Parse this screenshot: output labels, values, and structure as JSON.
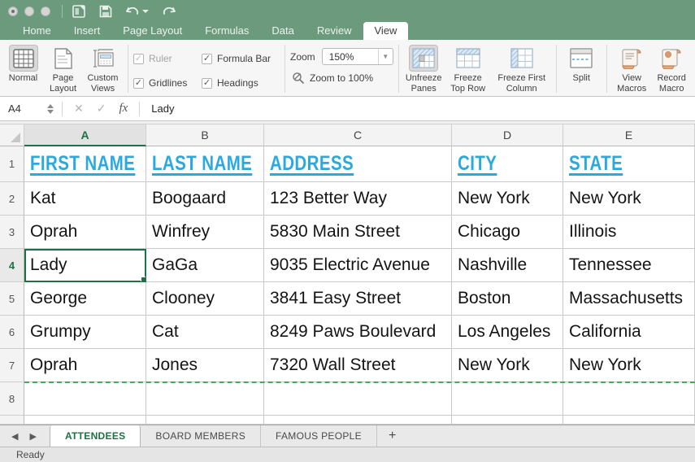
{
  "colors": {
    "title_green": "#6b9a7c",
    "accent_green": "#1e7145",
    "header_blue": "#2aa9e0"
  },
  "icons": {
    "cancel": "✕",
    "confirm": "✓",
    "check": "✓",
    "dropdown_caret": "▼",
    "nav_left": "◀",
    "nav_right": "▶"
  },
  "ribbon_tabs": {
    "items": [
      "Home",
      "Insert",
      "Page Layout",
      "Formulas",
      "Data",
      "Review",
      "View"
    ],
    "active": "View"
  },
  "ribbon": {
    "workbook_views": [
      {
        "line1": "Normal",
        "line2": ""
      },
      {
        "line1": "Page",
        "line2": "Layout"
      },
      {
        "line1": "Custom",
        "line2": "Views"
      }
    ],
    "show_options": [
      {
        "label": "Ruler",
        "glyph": "✓"
      },
      {
        "label": "Formula Bar",
        "glyph": "✓"
      },
      {
        "label": "Gridlines",
        "glyph": "✓"
      },
      {
        "label": "Headings",
        "glyph": "✓"
      }
    ],
    "zoom": {
      "label": "Zoom",
      "value": "150%",
      "zoom_100_label": "Zoom to 100%"
    },
    "freeze_buttons": [
      {
        "line1": "Unfreeze",
        "line2": "Panes"
      },
      {
        "line1": "Freeze",
        "line2": "Top Row"
      },
      {
        "line1": "Freeze First",
        "line2": "Column"
      }
    ],
    "split_label": "Split",
    "macro_buttons": [
      {
        "line1": "View",
        "line2": "Macros"
      },
      {
        "line1": "Record",
        "line2": "Macro"
      }
    ]
  },
  "formula_bar": {
    "name_box": "A4",
    "fx_label": "fx",
    "value": "Lady"
  },
  "sheet": {
    "columns": [
      "A",
      "B",
      "C",
      "D",
      "E"
    ],
    "selected_cell": "A4",
    "selected_column": "A",
    "selected_row": "4",
    "header_row": {
      "num": "1",
      "cells": [
        "FIRST NAME",
        "LAST NAME",
        "ADDRESS",
        "CITY",
        "STATE"
      ]
    },
    "rows": [
      {
        "num": "2",
        "cells": [
          "Kat",
          "Boogaard",
          "123 Better Way",
          "New York",
          "New York"
        ]
      },
      {
        "num": "3",
        "cells": [
          "Oprah",
          "Winfrey",
          "5830 Main Street",
          "Chicago",
          "Illinois"
        ]
      },
      {
        "num": "4",
        "cells": [
          "Lady",
          "GaGa",
          "9035 Electric Avenue",
          "Nashville",
          "Tennessee"
        ]
      },
      {
        "num": "5",
        "cells": [
          "George",
          "Clooney",
          "3841 Easy Street",
          "Boston",
          "Massachusetts"
        ]
      },
      {
        "num": "6",
        "cells": [
          "Grumpy",
          "Cat",
          "8249 Paws Boulevard",
          "Los Angeles",
          "California"
        ]
      },
      {
        "num": "7",
        "cells": [
          "Oprah",
          "Jones",
          "7320 Wall Street",
          "New York",
          "New York"
        ]
      },
      {
        "num": "8",
        "cells": [
          "",
          "",
          "",
          "",
          ""
        ]
      }
    ]
  },
  "sheet_tabs": {
    "tabs": [
      {
        "label": "ATTENDEES"
      },
      {
        "label": "BOARD MEMBERS"
      },
      {
        "label": "FAMOUS PEOPLE"
      }
    ],
    "add_label": "+"
  },
  "status_bar": {
    "text": "Ready"
  }
}
